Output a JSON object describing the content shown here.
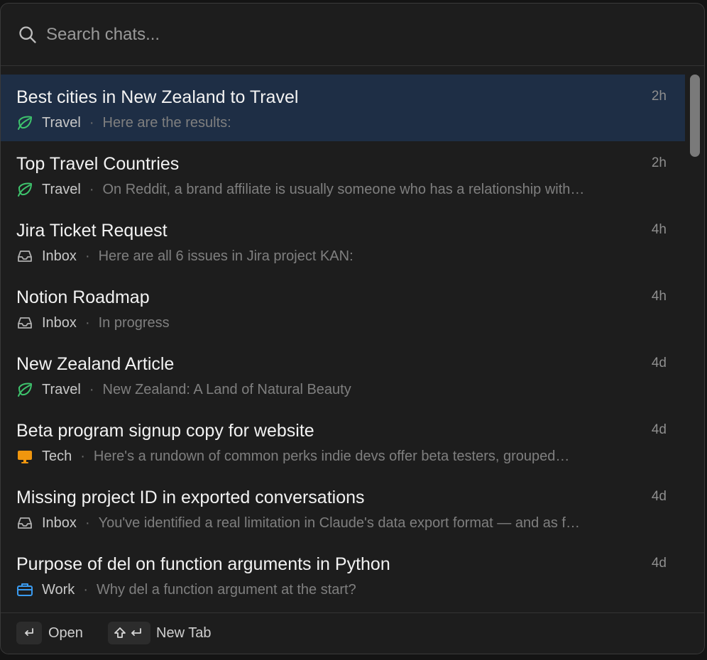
{
  "search": {
    "placeholder": "Search chats..."
  },
  "chats": [
    {
      "title": "Best cities in New Zealand to Travel",
      "project": "Travel",
      "project_icon": "leaf-icon",
      "preview": "Here are the results:",
      "time": "2h",
      "selected": true
    },
    {
      "title": "Top Travel Countries",
      "project": "Travel",
      "project_icon": "leaf-icon",
      "preview": "On Reddit, a brand affiliate is usually someone who has a relationship with…",
      "time": "2h"
    },
    {
      "title": "Jira Ticket Request",
      "project": "Inbox",
      "project_icon": "inbox-icon",
      "preview": "Here are all 6 issues in Jira project KAN:",
      "time": "4h"
    },
    {
      "title": "Notion Roadmap",
      "project": "Inbox",
      "project_icon": "inbox-icon",
      "preview": "In progress",
      "time": "4h"
    },
    {
      "title": "New Zealand Article",
      "project": "Travel",
      "project_icon": "leaf-icon",
      "preview": "New Zealand: A Land of Natural Beauty",
      "time": "4d"
    },
    {
      "title": "Beta program signup copy for website",
      "project": "Tech",
      "project_icon": "monitor-icon",
      "preview": "Here's a rundown of common perks indie devs offer beta testers, grouped…",
      "time": "4d"
    },
    {
      "title": "Missing project ID in exported conversations",
      "project": "Inbox",
      "project_icon": "inbox-icon",
      "preview": "You've identified a real limitation in Claude's data export format — and as f…",
      "time": "4d"
    },
    {
      "title": "Purpose of del on function arguments in Python",
      "project": "Work",
      "project_icon": "briefcase-icon",
      "preview": "Why del a function argument at the start?",
      "time": "4d"
    }
  ],
  "footer": {
    "open_label": "Open",
    "new_tab_label": "New Tab"
  },
  "colors": {
    "selected_row": "#1e2e45",
    "travel": "#3ec46d",
    "tech": "#f0960e",
    "work": "#3a9bf0",
    "inbox": "#b0b0b0"
  }
}
